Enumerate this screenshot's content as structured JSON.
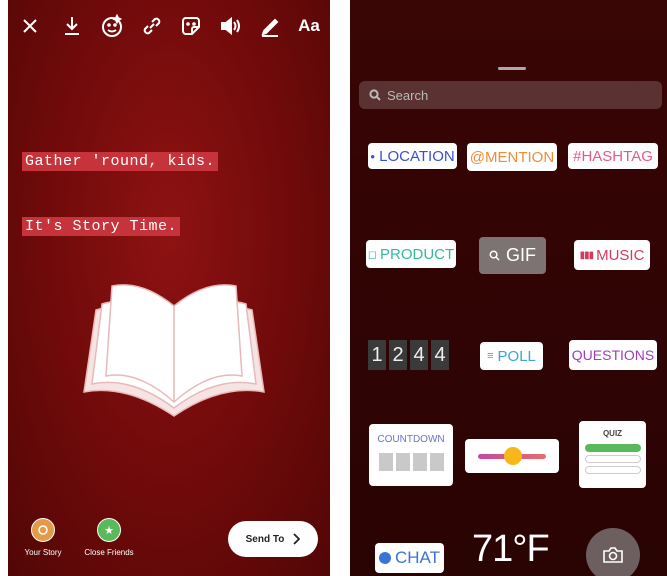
{
  "left": {
    "text_lines": [
      "Gather 'round, kids.",
      "It's Story Time."
    ],
    "bottom": {
      "your_story": "Your Story",
      "close_friends": "Close Friends",
      "send_to": "Send To"
    },
    "toolbar": {
      "text_tool": "Aa"
    }
  },
  "right": {
    "search_placeholder": "Search",
    "stickers": {
      "location": "LOCATION",
      "mention": "@MENTION",
      "hashtag": "#HASHTAG",
      "product": "PRODUCT",
      "gif": "GIF",
      "music": "MUSIC",
      "countdown_digits": [
        "1",
        "2",
        "4",
        "4"
      ],
      "poll": "POLL",
      "questions": "QUESTIONS",
      "countdown": "COUNTDOWN",
      "quiz": "QUIZ",
      "chat": "CHAT",
      "temperature": "71°F"
    }
  },
  "colors": {
    "story_bg": "#7a0b0b",
    "text_highlight": "#c7333b",
    "sticker_panel_bg": "#320404"
  }
}
